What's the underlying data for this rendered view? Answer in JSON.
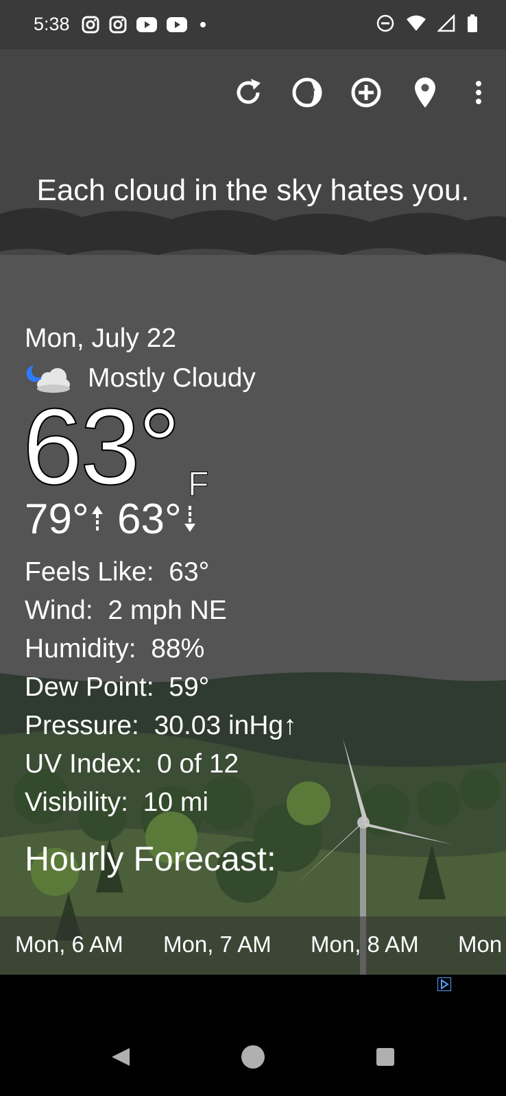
{
  "status_bar": {
    "time": "5:38",
    "left_icons": [
      "instagram-icon",
      "instagram-icon",
      "youtube-icon",
      "youtube-icon",
      "dot-icon"
    ],
    "right_icons": [
      "do-not-disturb-icon",
      "wifi-icon",
      "signal-icon",
      "battery-icon"
    ]
  },
  "toolbar": {
    "actions": [
      "refresh-icon",
      "moon-phase-icon",
      "add-location-icon",
      "location-pin-icon",
      "more-vert-icon"
    ]
  },
  "quote": "Each cloud in the sky hates you.",
  "weather": {
    "date": "Mon, July 22",
    "condition_icon": "partly-cloudy-night-icon",
    "condition": "Mostly Cloudy",
    "temperature": "63°",
    "unit": "F",
    "high": "79°",
    "low": "63°",
    "details": [
      {
        "label": "Feels Like:",
        "value": "63°"
      },
      {
        "label": "Wind:",
        "value": "2 mph NE"
      },
      {
        "label": "Humidity:",
        "value": "88%"
      },
      {
        "label": "Dew Point:",
        "value": "59°"
      },
      {
        "label": "Pressure:",
        "value": "30.03 inHg↑"
      },
      {
        "label": "UV Index:",
        "value": "0 of 12"
      },
      {
        "label": "Visibility:",
        "value": "10 mi"
      }
    ]
  },
  "hourly": {
    "title": "Hourly Forecast:",
    "items": [
      "Mon, 6 AM",
      "Mon, 7 AM",
      "Mon, 8 AM",
      "Mon"
    ]
  },
  "nav": {
    "buttons": [
      "back-icon",
      "home-icon",
      "recents-icon"
    ]
  },
  "colors": {
    "background": "#545454",
    "status_bar": "#3a3a3a",
    "moon_accent": "#2f7bff"
  }
}
